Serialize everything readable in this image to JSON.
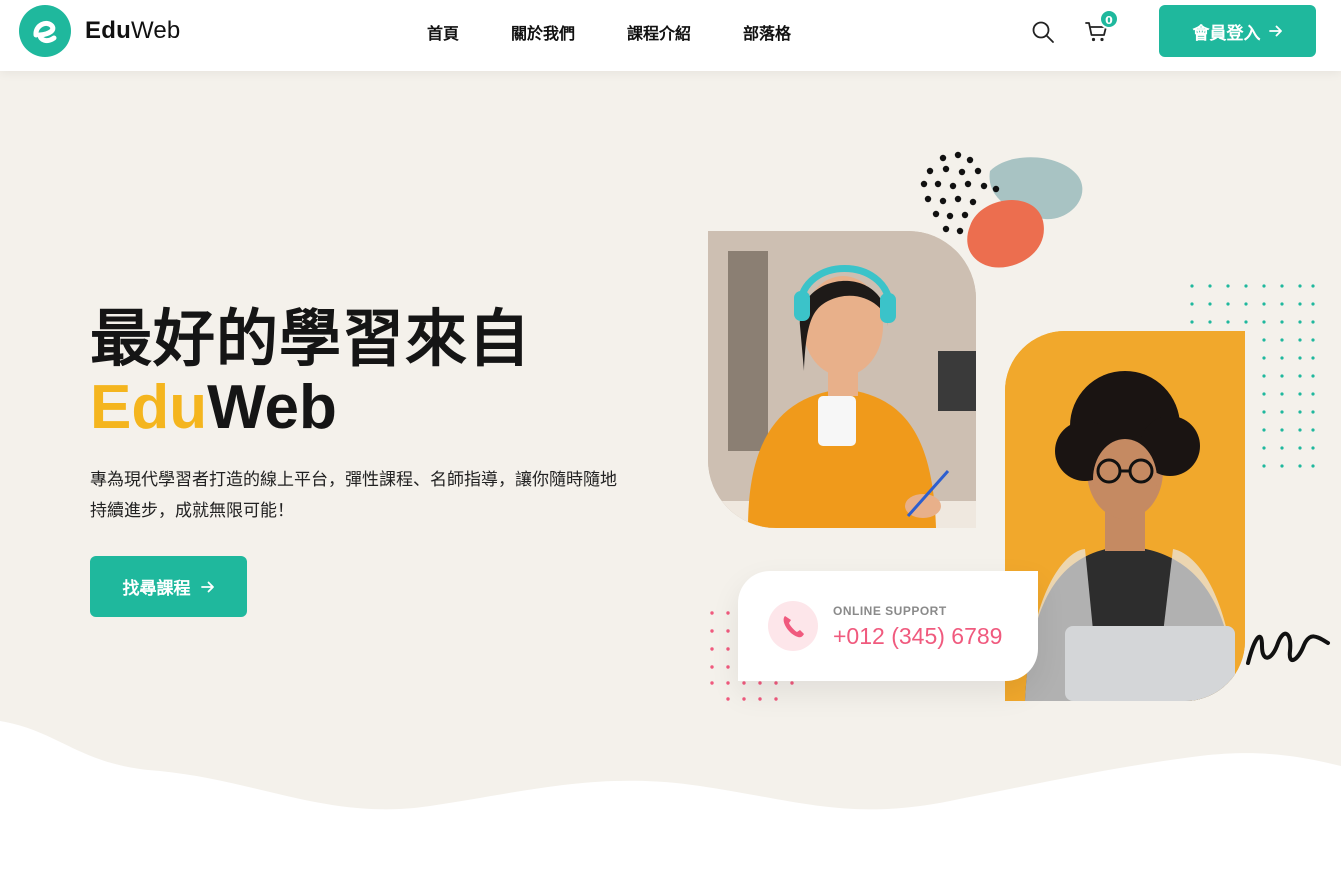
{
  "brand": {
    "name_bold": "Edu",
    "name_light": "Web",
    "logo_letter": "e"
  },
  "nav": {
    "items": [
      "首頁",
      "關於我們",
      "課程介紹",
      "部落格"
    ]
  },
  "header": {
    "cart_count": "0",
    "login_label": "會員登入"
  },
  "hero": {
    "title_line1": "最好的學習來自",
    "brand_part1": "Edu",
    "brand_part2": "Web",
    "description": "專為現代學習者打造的線上平台，彈性課程、名師指導，讓你隨時隨地持續進步，成就無限可能！",
    "cta_label": "找尋課程"
  },
  "support": {
    "label": "ONLINE SUPPORT",
    "phone": "+012 (345) 6789"
  },
  "colors": {
    "accent": "#1fb89d",
    "yellow": "#f4b51e",
    "hero_bg": "#f4f1eb",
    "pink": "#f05a7e",
    "orange_blob": "#ec6e4f",
    "blue_blob": "#a8c3c3"
  },
  "icons": [
    "search-icon",
    "cart-icon",
    "arrow-right-icon",
    "phone-icon"
  ]
}
